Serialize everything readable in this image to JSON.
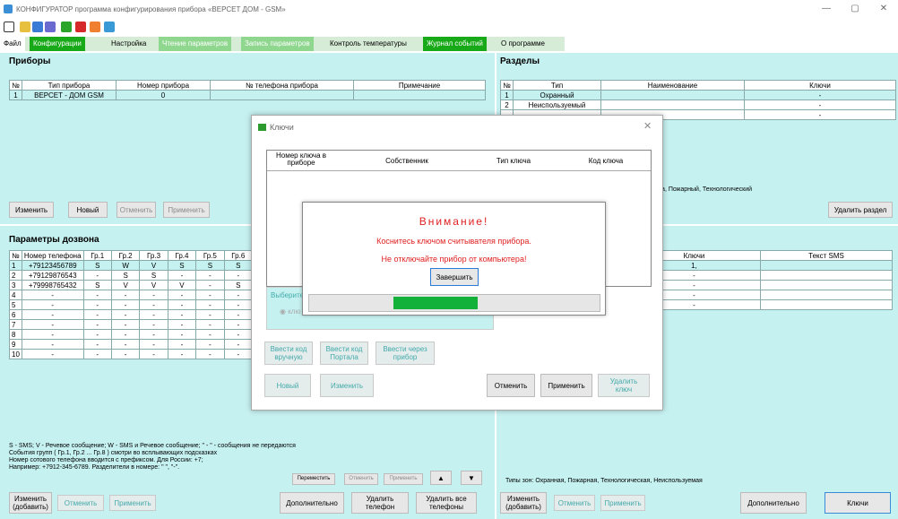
{
  "window": {
    "title": "КОНФИГУРАТОР программа конфигурирования прибора «ВЕРСЕТ ДОМ - GSM»",
    "min": "—",
    "max": "▢",
    "close": "✕"
  },
  "menu": {
    "items": [
      {
        "label": "Файл"
      },
      {
        "label": "Конфигурации"
      },
      {
        "label": "Настройка"
      },
      {
        "label": "Чтение параметров"
      },
      {
        "label": "Запись параметров"
      },
      {
        "label": "Контроль температуры"
      },
      {
        "label": "Журнал событий"
      },
      {
        "label": "О программе"
      }
    ]
  },
  "devices": {
    "title": "Приборы",
    "columns": [
      "№",
      "Тип прибора",
      "Номер прибора",
      "№ телефона прибора",
      "Примечание"
    ],
    "rows": [
      [
        "1",
        "ВЕРСЕТ - ДОМ GSM",
        "0",
        "",
        ""
      ]
    ],
    "buttons": {
      "edit": "Изменить",
      "new": "Новый",
      "cancel": "Отменить",
      "apply": "Применить"
    }
  },
  "sections": {
    "title": "Разделы",
    "columns": [
      "№",
      "Тип",
      "Наименование",
      "Ключи"
    ],
    "rows": [
      [
        "1",
        "Охранный",
        "",
        "-"
      ],
      [
        "2",
        "Неиспользуемый",
        "",
        "-"
      ],
      [
        "",
        "",
        "",
        "-"
      ]
    ],
    "types_note": "доступа, Пожарный, Технологический",
    "delete_button": "Удалить раздел"
  },
  "dial": {
    "title": "Параметры дозвона",
    "columns": [
      "№",
      "Номер телефона",
      "Гр.1",
      "Гр.2",
      "Гр.3",
      "Гр.4",
      "Гр.5",
      "Гр.6"
    ],
    "rows": [
      [
        "1",
        "+79123456789",
        "S",
        "W",
        "V",
        "S",
        "S",
        "S"
      ],
      [
        "2",
        "+79129876543",
        "-",
        "S",
        "S",
        "-",
        "-",
        "-"
      ],
      [
        "3",
        "+79998765432",
        "S",
        "V",
        "V",
        "V",
        "-",
        "S"
      ],
      [
        "4",
        "-",
        "-",
        "-",
        "-",
        "-",
        "-",
        "-"
      ],
      [
        "5",
        "-",
        "-",
        "-",
        "-",
        "-",
        "-",
        "-"
      ],
      [
        "6",
        "-",
        "-",
        "-",
        "-",
        "-",
        "-",
        "-"
      ],
      [
        "7",
        "-",
        "-",
        "-",
        "-",
        "-",
        "-",
        "-"
      ],
      [
        "8",
        "-",
        "-",
        "-",
        "-",
        "-",
        "-",
        "-"
      ],
      [
        "9",
        "-",
        "-",
        "-",
        "-",
        "-",
        "-",
        "-"
      ],
      [
        "10",
        "-",
        "-",
        "-",
        "-",
        "-",
        "-",
        "-"
      ]
    ],
    "legend": [
      "S - SMS;  V - Речевое сообщение;  W - SMS и Речевое сообщение; \" - \" - сообщения не передаются",
      "События групп ( Гр.1, Гр.2 ... Гр.8 ) смотри во всплывающих подсказках",
      "Номер сотового телефона вводится с префиксом. Для России: +7;",
      "Например: +7912-345-6789. Разделители в номере: \" \", \"-\"."
    ],
    "buttons": {
      "move": "Переместить",
      "cancel_small": "Отменить",
      "apply_small": "Применить",
      "edit_add": "Изменить\n(добавить)",
      "cancel": "Отменить",
      "apply": "Применить",
      "more": "Дополнительно",
      "delete_phone": "Удалить\nтелефон",
      "delete_all": "Удалить все\nтелефоны"
    }
  },
  "sms": {
    "columns": [
      "Ключи",
      "Текст SMS"
    ],
    "rows": [
      [
        "1,",
        ""
      ],
      [
        "-",
        ""
      ],
      [
        "-",
        ""
      ],
      [
        "-",
        ""
      ],
      [
        "-",
        ""
      ]
    ],
    "zone_types": "Типы зон: Охранная, Пожарная, Технологическая, Неиспользуемая",
    "buttons": {
      "edit_add": "Изменить\n(добавить)",
      "cancel": "Отменить",
      "apply": "Применить",
      "more": "Дополнительно",
      "keys": "Ключи"
    }
  },
  "keys_dialog": {
    "title": "Ключи",
    "columns": [
      "Номер ключа в\nприборе",
      "Собственник",
      "Тип ключа",
      "Код ключа"
    ],
    "select_label": "Выберите",
    "radio_label": "клю",
    "buttons": {
      "enter_manual": "Ввести код\nвручную",
      "enter_portal": "Ввести код\nПортала",
      "enter_device": "Ввести через\nприбор",
      "new": "Новый",
      "edit": "Изменить",
      "cancel": "Отменить",
      "apply": "Применить",
      "delete_key": "Удалить\nключ"
    }
  },
  "alert": {
    "title": "Внимание!",
    "line1": "Коснитесь ключом считывателя прибора.",
    "line2": "Не отключайте прибор от компьютера!",
    "finish": "Завершить",
    "progress": 0.4,
    "colors": {
      "text": "#e02020",
      "progress": "#13b13a"
    }
  }
}
